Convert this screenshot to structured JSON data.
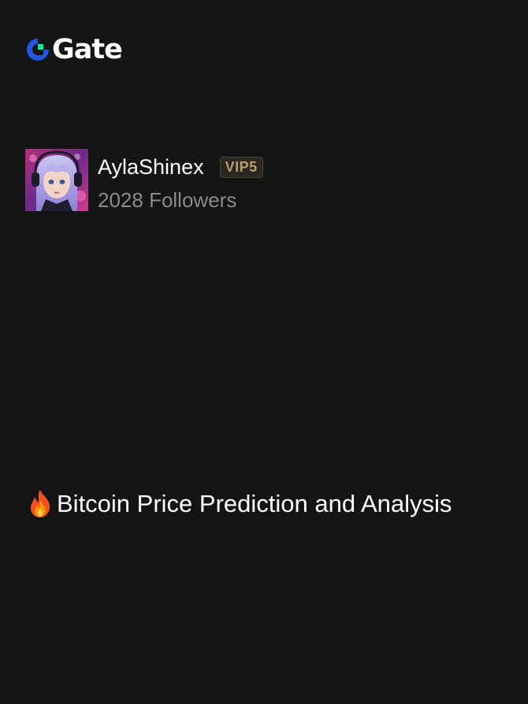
{
  "brand": {
    "name": "Gate",
    "colors": {
      "blue": "#2354E6",
      "green": "#17E6A1"
    }
  },
  "profile": {
    "username": "AylaShinex",
    "badge": "VIP5",
    "followers": "2028 Followers"
  },
  "post": {
    "icon": "fire-emoji",
    "title": "Bitcoin Price Prediction and Analysis"
  },
  "colors": {
    "background": "#141414",
    "text_primary": "#FFFFFF",
    "text_secondary": "#8A8A8A",
    "badge_text": "#B89D6A"
  }
}
